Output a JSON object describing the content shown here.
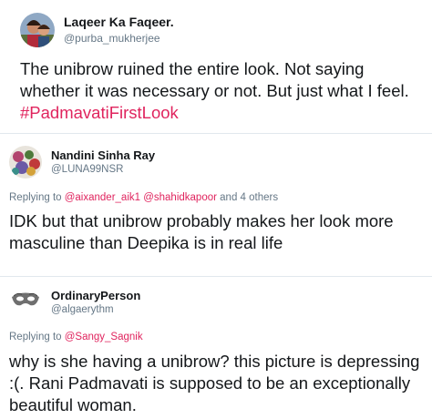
{
  "tweets": [
    {
      "name": "Laqeer Ka Faqeer.",
      "handle": "@purba_mukherjee",
      "text": "The unibrow ruined the entire look. Not saying whether it was necessary or not. But just what I feel. ",
      "hashtag": "#PadmavatiFirstLook"
    },
    {
      "name": "Nandini Sinha Ray",
      "handle": "@LUNA99NSR",
      "reply_prefix": "Replying to ",
      "reply_mentions": [
        "@aixander_aik1",
        "@shahidkapoor"
      ],
      "reply_suffix": " and 4 others",
      "text": "IDK but that unibrow probably makes her look more masculine than Deepika is in real life"
    },
    {
      "name": "OrdinaryPerson",
      "handle": "@algaerythm",
      "reply_prefix": "Replying to ",
      "reply_mentions": [
        "@Sangy_Sagnik"
      ],
      "text": "why is she having a unibrow? this picture is depressing :(. Rani Padmavati is supposed to be an exceptionally beautiful woman."
    }
  ],
  "colors": {
    "name": "#14171a",
    "handle": "#657786",
    "hashtag": "#e0245e",
    "divider": "#e1e8ed"
  }
}
